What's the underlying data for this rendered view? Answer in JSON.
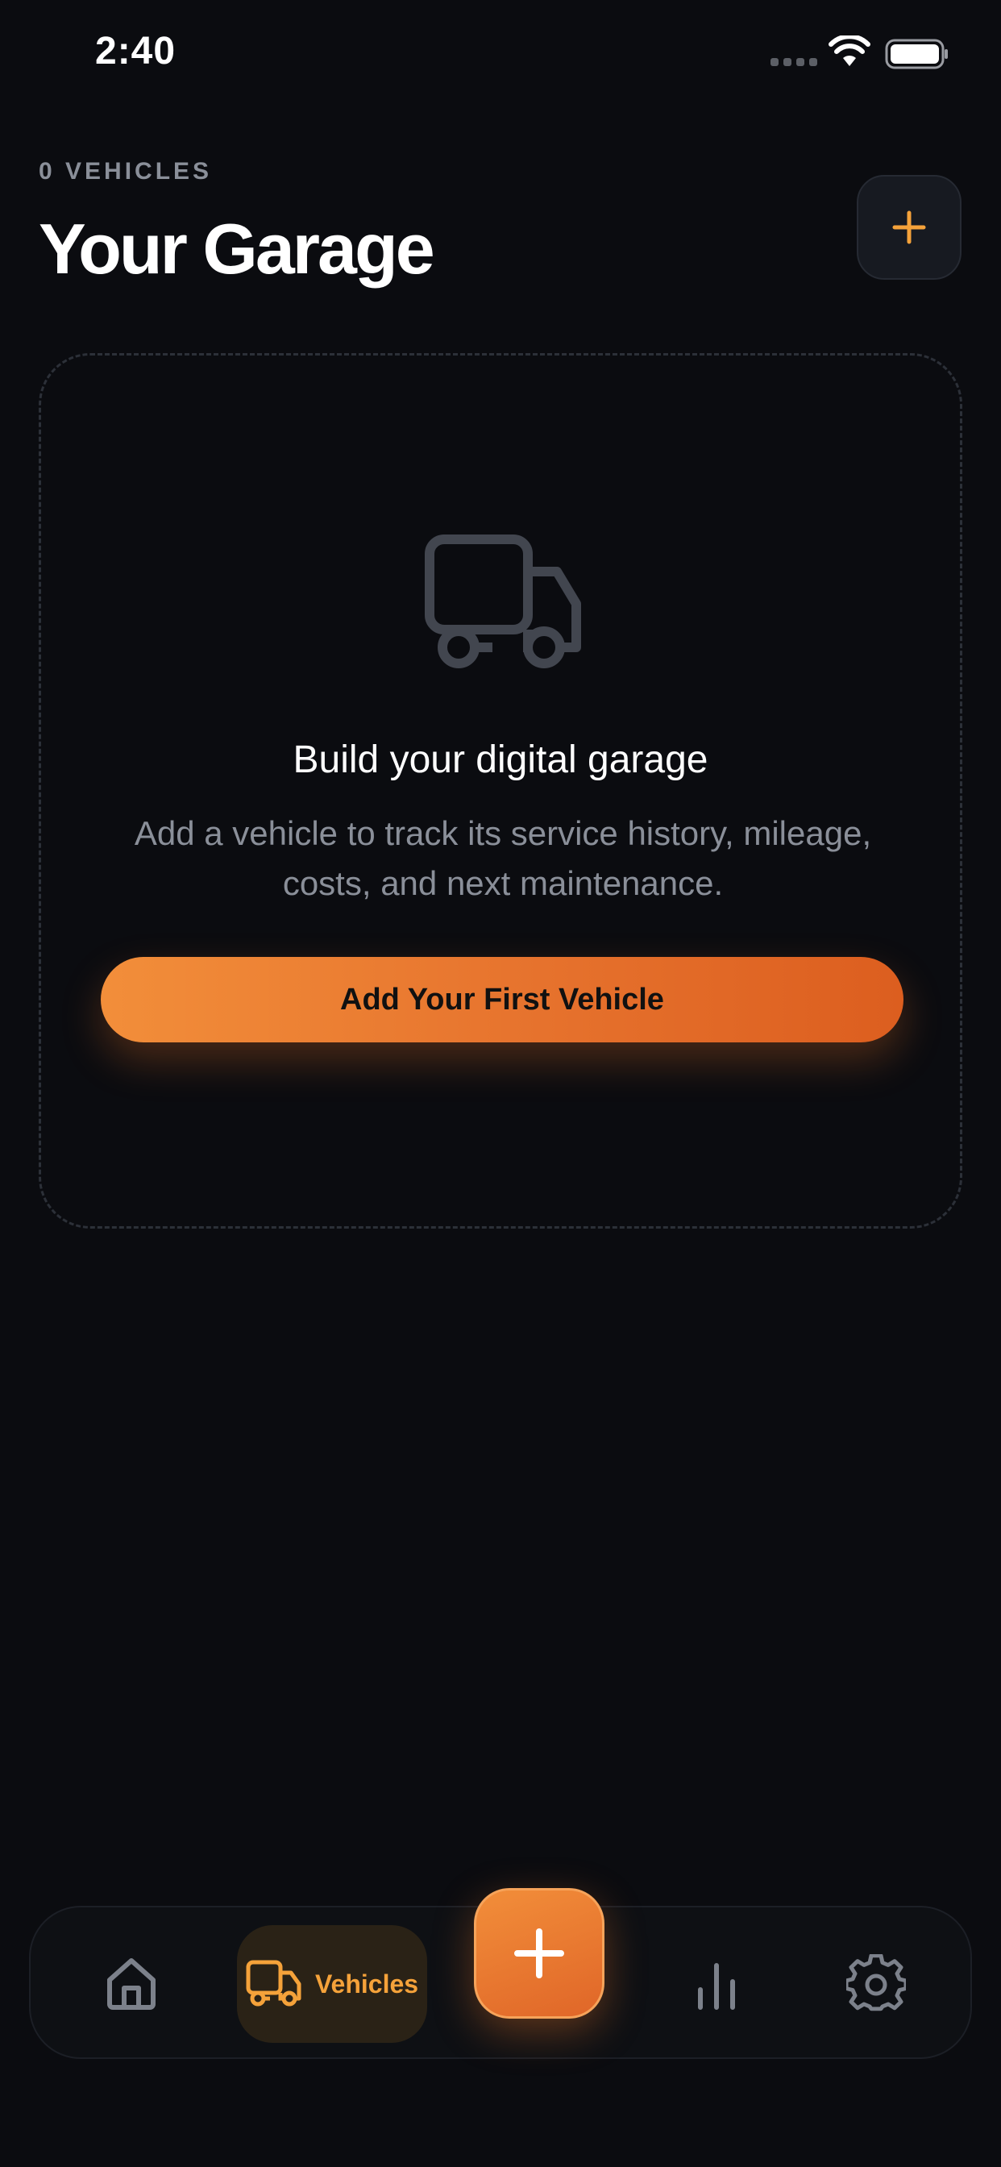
{
  "status_bar": {
    "time": "2:40"
  },
  "header": {
    "vehicle_count": "0 VEHICLES",
    "title": "Your Garage",
    "add_icon": "plus-icon"
  },
  "empty_state": {
    "icon": "truck-icon",
    "title": "Build your digital garage",
    "description": "Add a vehicle to track its service history, mileage, costs, and next maintenance.",
    "cta_label": "Add Your First Vehicle"
  },
  "tab_bar": {
    "items": [
      {
        "icon": "home-icon",
        "active": false
      },
      {
        "icon": "truck-icon",
        "label": "Vehicles",
        "active": true
      },
      {
        "icon": "plus-icon",
        "active": false
      },
      {
        "icon": "bar-chart-icon",
        "active": false
      },
      {
        "icon": "gear-icon",
        "active": false
      }
    ]
  },
  "colors": {
    "background": "#0b0c10",
    "accent": "#f5a23a",
    "cta_gradient_start": "#f28e3a",
    "cta_gradient_end": "#dc5e1f",
    "muted_text": "#8a8f99"
  }
}
